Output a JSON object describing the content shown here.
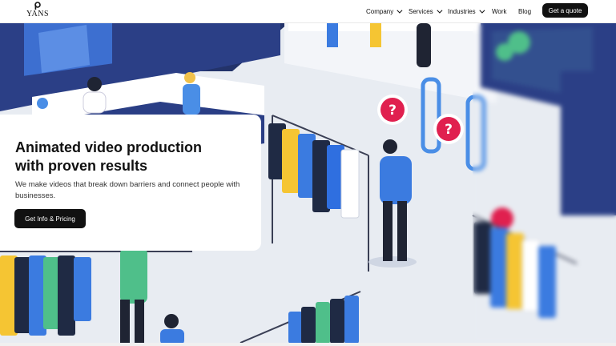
{
  "brand": {
    "name": "YANS"
  },
  "nav": {
    "company": "Company",
    "services": "Services",
    "industries": "Industries",
    "work": "Work",
    "blog": "Blog",
    "cta": "Get a quote"
  },
  "hero": {
    "headline_line1": "Animated video production",
    "headline_line2": "with proven results",
    "subcopy": "We make videos that break down barriers and connect people with businesses.",
    "cta": "Get Info & Pricing"
  },
  "colors": {
    "accent": "#111111",
    "illustration_blue": "#2f6fe0",
    "illustration_navy": "#1f2a44",
    "illustration_yellow": "#f5c533",
    "illustration_green": "#4fbf8a",
    "illustration_red": "#e0204f"
  },
  "icons": [
    "logo-mark-icon",
    "chevron-down-icon",
    "question-mark-icon"
  ]
}
